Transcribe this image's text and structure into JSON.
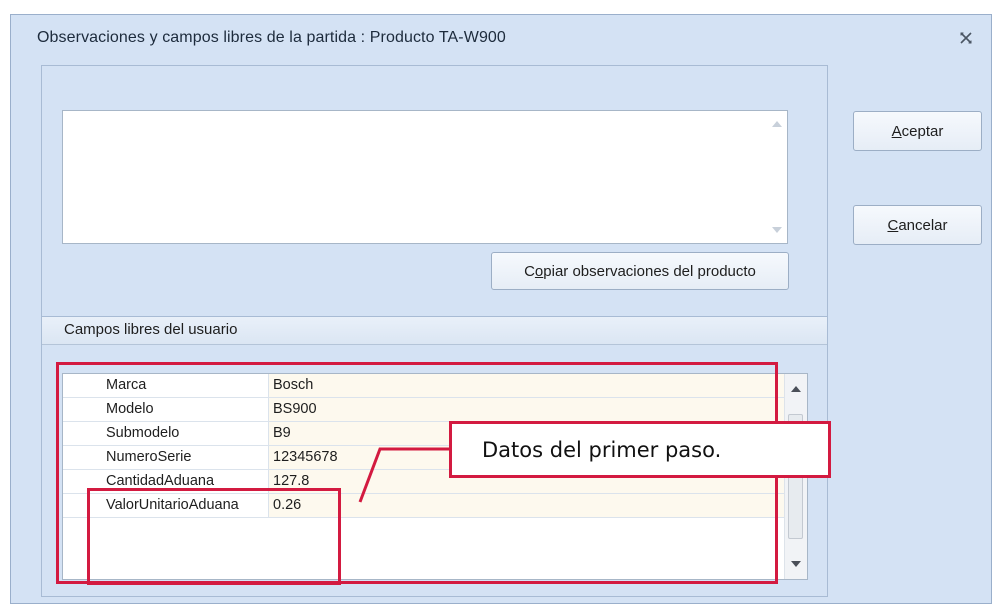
{
  "window": {
    "title": "Observaciones y campos libres de la partida : Producto TA-W900",
    "close_icon": "close-icon"
  },
  "observations": {
    "value": "",
    "copy_button": {
      "pre": "C",
      "ul": "o",
      "post": "piar observaciones del producto"
    }
  },
  "buttons": {
    "accept": {
      "ul": "A",
      "rest": "ceptar"
    },
    "cancel": {
      "ul": "C",
      "rest": "ancelar"
    }
  },
  "user_fields": {
    "title": "Campos libres del usuario",
    "rows": [
      {
        "name": "Marca",
        "value": "Bosch"
      },
      {
        "name": "Modelo",
        "value": "BS900"
      },
      {
        "name": "Submodelo",
        "value": "B9"
      },
      {
        "name": "NumeroSerie",
        "value": "12345678"
      },
      {
        "name": "CantidadAduana",
        "value": "127.8"
      },
      {
        "name": "ValorUnitarioAduana",
        "value": "0.26"
      }
    ]
  },
  "annotation": {
    "callout_text": "Datos del primer paso."
  },
  "colors": {
    "highlight": "#d31a40",
    "window_bg": "#d4e2f4",
    "value_cell_bg": "#fdf9ee"
  }
}
